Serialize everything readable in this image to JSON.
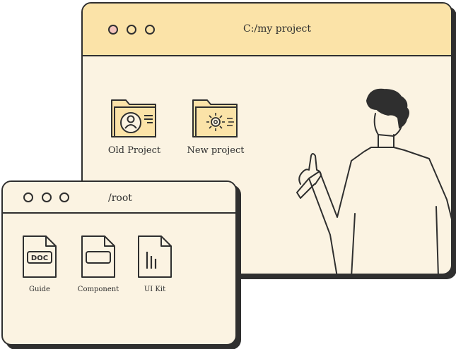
{
  "main_window": {
    "title": "C:/my project",
    "folders": [
      {
        "label": "Old Project",
        "icon": "user-folder-icon"
      },
      {
        "label": "New project",
        "icon": "sun-folder-icon"
      }
    ]
  },
  "root_window": {
    "title": "/root",
    "files": [
      {
        "label": "Guide",
        "icon_text": "DOC",
        "icon": "doc-file-icon"
      },
      {
        "label": "Component",
        "icon": "component-file-icon"
      },
      {
        "label": "UI Kit",
        "icon": "ui-kit-file-icon"
      }
    ]
  },
  "colors": {
    "window_bg": "#fbf3e2",
    "titlebar_bg": "#fbe3a8",
    "close_dot": "#f3c3bc",
    "outline": "#2f2f2f",
    "folder_fill": "#fbe3a8"
  }
}
